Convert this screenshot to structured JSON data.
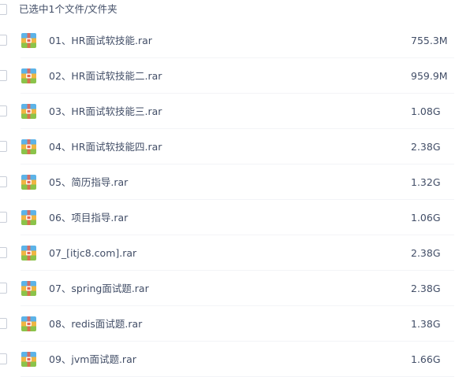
{
  "header": {
    "selection_text": "已选中1个文件/文件夹"
  },
  "files": [
    {
      "name": "01、HR面试软技能.rar",
      "size": "755.3M",
      "icon": "archive-icon"
    },
    {
      "name": "02、HR面试软技能二.rar",
      "size": "959.9M",
      "icon": "archive-icon"
    },
    {
      "name": "03、HR面试软技能三.rar",
      "size": "1.08G",
      "icon": "archive-icon"
    },
    {
      "name": "04、HR面试软技能四.rar",
      "size": "2.38G",
      "icon": "archive-icon"
    },
    {
      "name": "05、简历指导.rar",
      "size": "1.32G",
      "icon": "archive-icon"
    },
    {
      "name": "06、项目指导.rar",
      "size": "1.06G",
      "icon": "archive-icon"
    },
    {
      "name": "07_[itjc8.com].rar",
      "size": "2.38G",
      "icon": "archive-icon"
    },
    {
      "name": "07、spring面试题.rar",
      "size": "2.38G",
      "icon": "archive-icon"
    },
    {
      "name": "08、redis面试题.rar",
      "size": "1.38G",
      "icon": "archive-icon"
    },
    {
      "name": "09、jvm面试题.rar",
      "size": "1.66G",
      "icon": "archive-icon"
    }
  ],
  "colors": {
    "text": "#424e67",
    "icon_top": "#5cb3e8",
    "icon_middle": "#f0b542",
    "icon_bottom": "#8bc34a",
    "icon_band": "#e8624f"
  }
}
